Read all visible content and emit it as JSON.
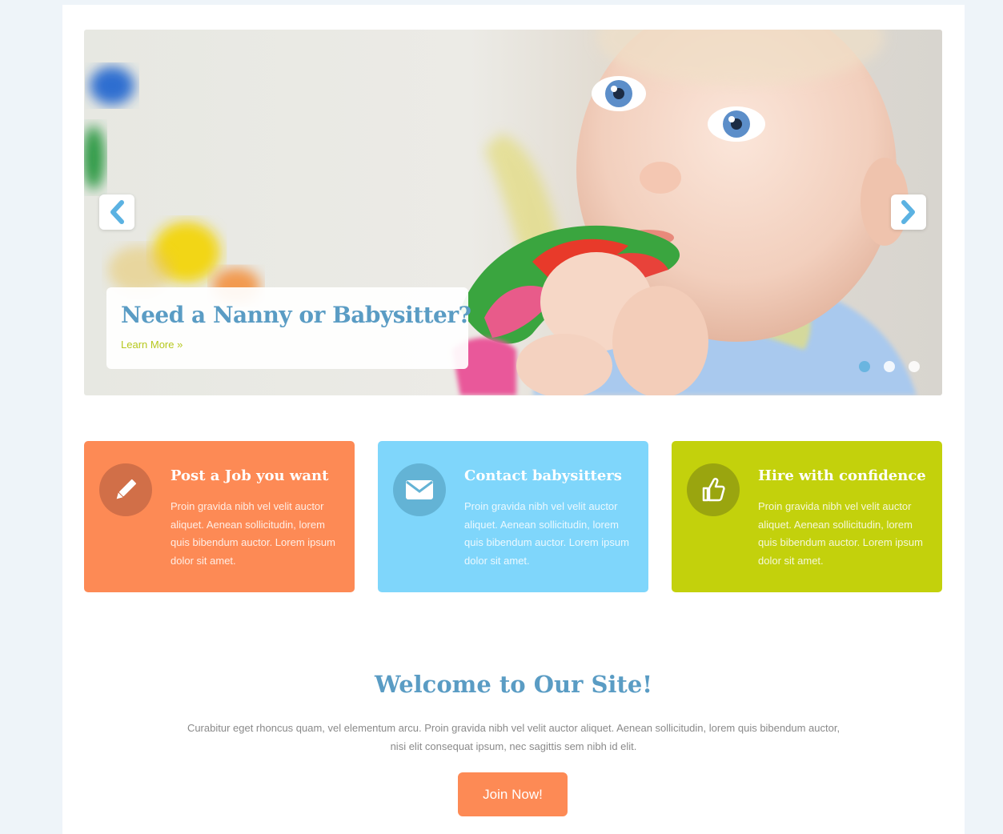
{
  "slider": {
    "caption_title": "Need a Nanny or Babysitter?",
    "caption_link": "Learn More »",
    "slide_count": 3,
    "active_slide": 1
  },
  "features": [
    {
      "title": "Post a Job you want",
      "text": "Proin gravida nibh vel velit auctor aliquet. Aenean sollicitudin, lorem quis bibendum auctor. Lorem ipsum dolor sit amet.",
      "icon": "pencil-icon",
      "color": "#fd8a55"
    },
    {
      "title": "Contact babysitters",
      "text": "Proin gravida nibh vel velit auctor aliquet. Aenean sollicitudin, lorem quis bibendum auctor. Lorem ipsum dolor sit amet.",
      "icon": "envelope-icon",
      "color": "#7fd6fb"
    },
    {
      "title": "Hire with confidence",
      "text": "Proin gravida nibh vel velit auctor aliquet. Aenean sollicitudin, lorem quis bibendum auctor. Lorem ipsum dolor sit amet.",
      "icon": "thumbs-up-icon",
      "color": "#c3d10c"
    }
  ],
  "welcome": {
    "title": "Welcome to Our Site!",
    "text": "Curabitur eget rhoncus quam, vel elementum arcu. Proin gravida nibh vel velit auctor aliquet. Aenean sollicitudin, lorem quis bibendum auctor, nisi elit consequat ipsum, nec sagittis sem nibh id elit.",
    "button": "Join Now!"
  },
  "colors": {
    "accent_blue": "#5a9cc4",
    "accent_green": "#b6c81e",
    "accent_orange": "#fd8a55"
  }
}
